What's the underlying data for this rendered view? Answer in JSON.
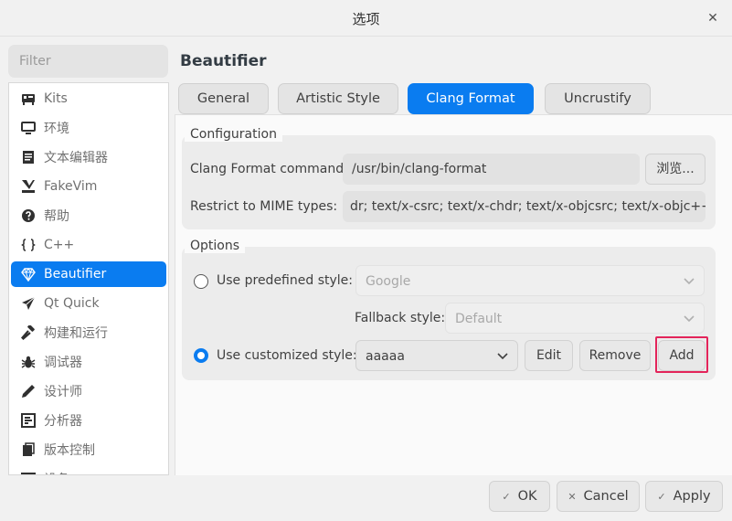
{
  "window": {
    "title": "选项",
    "close_glyph": "✕"
  },
  "filter": {
    "placeholder": "Filter"
  },
  "sidebar": {
    "items": [
      {
        "label": "Kits",
        "icon": "kits-icon"
      },
      {
        "label": "环境",
        "icon": "monitor-icon"
      },
      {
        "label": "文本编辑器",
        "icon": "text-editor-icon"
      },
      {
        "label": "FakeVim",
        "icon": "fakevim-icon"
      },
      {
        "label": "帮助",
        "icon": "help-icon"
      },
      {
        "label": "C++",
        "icon": "braces-icon"
      },
      {
        "label": "Beautifier",
        "icon": "diamond-icon"
      },
      {
        "label": "Qt Quick",
        "icon": "paper-plane-icon"
      },
      {
        "label": "构建和运行",
        "icon": "hammer-icon"
      },
      {
        "label": "调试器",
        "icon": "bug-icon"
      },
      {
        "label": "设计师",
        "icon": "pencil-icon"
      },
      {
        "label": "分析器",
        "icon": "analyzer-icon"
      },
      {
        "label": "版本控制",
        "icon": "version-control-icon"
      },
      {
        "label": "设备",
        "icon": "device-icon"
      }
    ],
    "active_index": 6
  },
  "page": {
    "title": "Beautifier"
  },
  "tabs": [
    {
      "label": "General"
    },
    {
      "label": "Artistic Style"
    },
    {
      "label": "Clang Format"
    },
    {
      "label": "Uncrustify"
    }
  ],
  "configuration": {
    "title": "Configuration",
    "command_label": "Clang Format command:",
    "command_value": "/usr/bin/clang-format",
    "browse_label": "浏览...",
    "mime_label": "Restrict to MIME types:",
    "mime_value": "dr; text/x-csrc; text/x-chdr; text/x-objcsrc; text/x-objc++src"
  },
  "options": {
    "title": "Options",
    "predefined_label": "Use predefined style:",
    "predefined_value": "Google",
    "fallback_label": "Fallback style:",
    "fallback_value": "Default",
    "customized_label": "Use customized style:",
    "customized_value": "aaaaa",
    "edit_label": "Edit",
    "remove_label": "Remove",
    "add_label": "Add"
  },
  "footer": {
    "ok_label": "OK",
    "cancel_label": "Cancel",
    "apply_label": "Apply"
  },
  "colors": {
    "accent": "#0a7cf0",
    "highlight": "#e3245a"
  }
}
